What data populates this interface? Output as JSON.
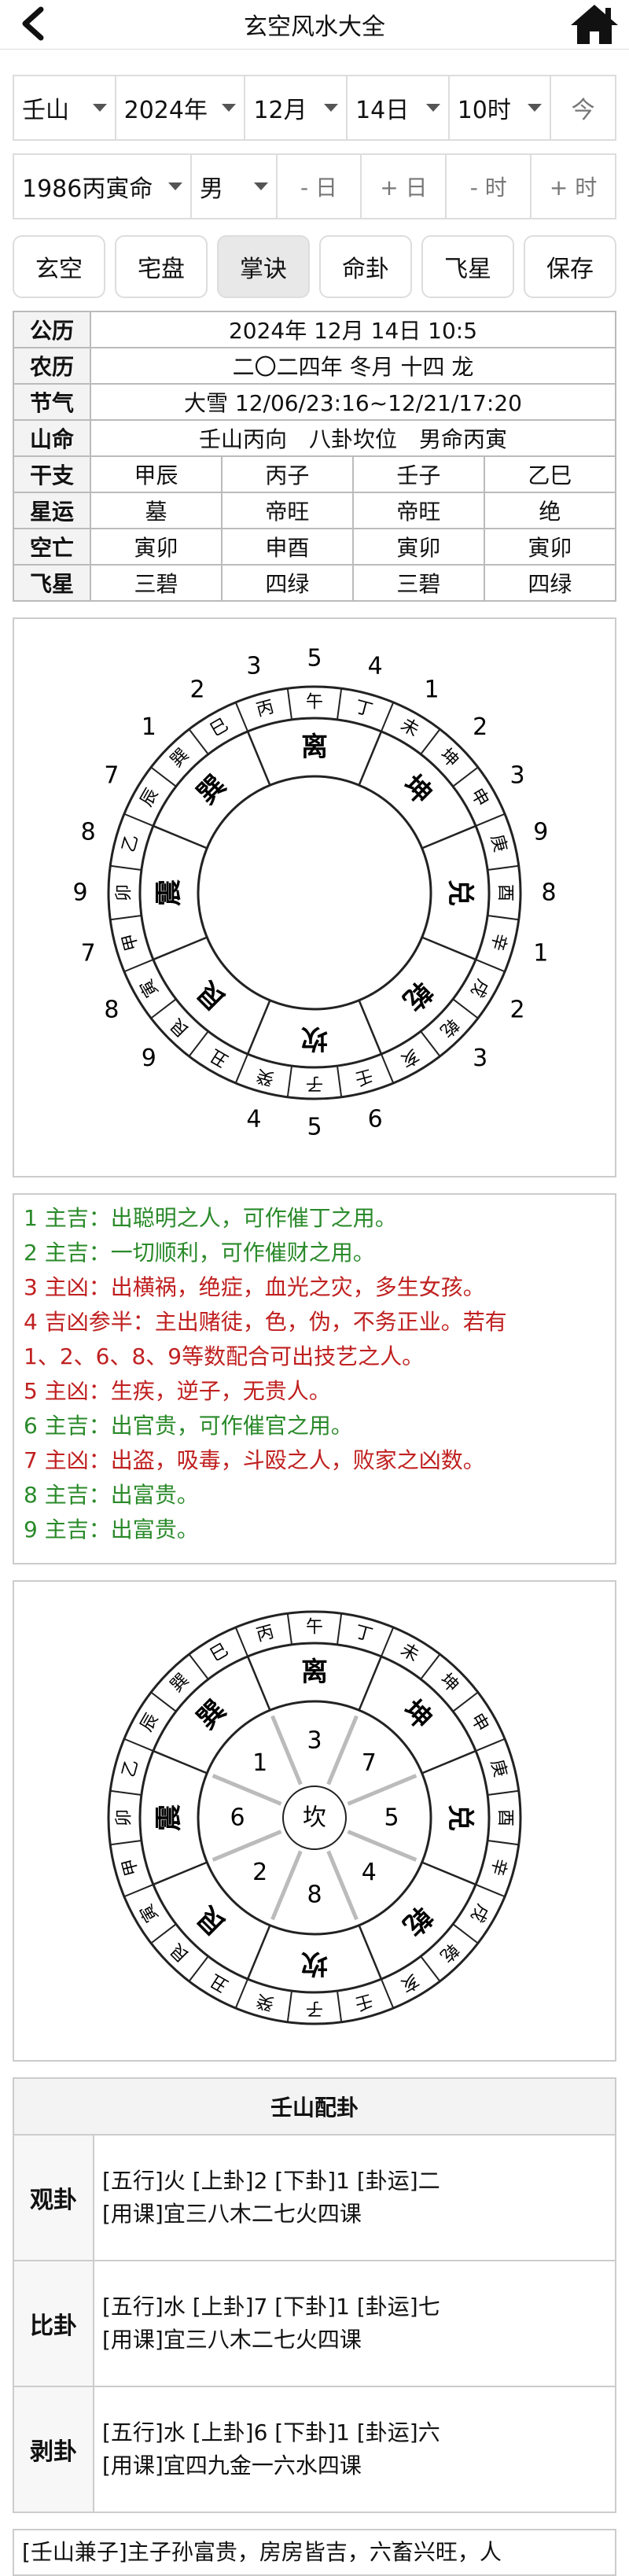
{
  "header": {
    "title": "玄空风水大全"
  },
  "selectors": {
    "mountain": "壬山",
    "year": "2024年",
    "month": "12月",
    "day": "14日",
    "hour": "10时",
    "today": "今",
    "birth": "1986丙寅命",
    "gender": "男",
    "adj": [
      "- 日",
      "+ 日",
      "- 时",
      "+ 时"
    ]
  },
  "buttons": [
    "玄空",
    "宅盘",
    "掌诀",
    "命卦",
    "飞星",
    "保存"
  ],
  "info": {
    "gongli": {
      "label": "公历",
      "value": "2024年 12月 14日 10:5"
    },
    "nongli": {
      "label": "农历",
      "value": "二〇二四年 冬月 十四 龙"
    },
    "jieqi": {
      "label": "节气",
      "value": "大雪 12/06/23:16~12/21/17:20"
    },
    "shanming": {
      "label": "山命",
      "value": "壬山丙向　八卦坎位　男命丙寅"
    },
    "ganzhi": {
      "label": "干支",
      "cells": [
        "甲辰",
        "丙子",
        "壬子",
        "乙巳"
      ]
    },
    "xingyun": {
      "label": "星运",
      "cells": [
        "墓",
        "帝旺",
        "帝旺",
        "绝"
      ]
    },
    "kongwang": {
      "label": "空亡",
      "cells": [
        "寅卯",
        "申酉",
        "寅卯",
        "寅卯"
      ]
    },
    "feixing": {
      "label": "飞星",
      "cells": [
        "三碧",
        "四绿",
        "三碧",
        "四绿"
      ]
    }
  },
  "wheel": {
    "mountains": [
      "午",
      "丁",
      "未",
      "坤",
      "申",
      "庚",
      "酉",
      "辛",
      "戌",
      "乾",
      "亥",
      "壬",
      "子",
      "癸",
      "丑",
      "艮",
      "寅",
      "甲",
      "卯",
      "乙",
      "辰",
      "巽",
      "巳",
      "丙"
    ],
    "trigrams": [
      "离",
      "坤",
      "兑",
      "乾",
      "坎",
      "艮",
      "震",
      "巽"
    ],
    "outer_numbers": [
      "5",
      "4",
      "1",
      "2",
      "3",
      "9",
      "8",
      "1",
      "2",
      "3",
      "6",
      "5",
      "4",
      "9",
      "8",
      "7",
      "9",
      "8",
      "7",
      "1",
      "2",
      "3"
    ],
    "center": "坎",
    "inner_numbers": [
      "3",
      "7",
      "5",
      "4",
      "8",
      "2",
      "6",
      "1"
    ]
  },
  "readings": [
    {
      "text": "1 主吉：出聪明之人，可作催丁之用。",
      "color": "g"
    },
    {
      "text": "2 主吉：一切顺利，可作催财之用。",
      "color": "g"
    },
    {
      "text": "3 主凶：出横祸，绝症，血光之灾，多生女孩。",
      "color": "r"
    },
    {
      "text": "4 吉凶参半：主出赌徒，色，伪，不务正业。若有",
      "color": "r"
    },
    {
      "text": "1、2、6、8、9等数配合可出技艺之人。",
      "color": "r"
    },
    {
      "text": "5 主凶：生疾，逆子，无贵人。",
      "color": "r"
    },
    {
      "text": "6 主吉：出官贵，可作催官之用。",
      "color": "g"
    },
    {
      "text": "7 主凶：出盗，吸毒，斗殴之人，败家之凶数。",
      "color": "r"
    },
    {
      "text": "8 主吉：出富贵。",
      "color": "g"
    },
    {
      "text": "9 主吉：出富贵。",
      "color": "g"
    }
  ],
  "peigua": {
    "title": "壬山配卦",
    "items": [
      {
        "name": "观卦",
        "line1": "[五行]火 [上卦]2 [下卦]1 [卦运]二",
        "line2": "[用课]宜三八木二七火四课"
      },
      {
        "name": "比卦",
        "line1": "[五行]水 [上卦]7 [下卦]1 [卦运]七",
        "line2": "[用课]宜三八木二七火四课"
      },
      {
        "name": "剥卦",
        "line1": "[五行]水 [上卦]6 [下卦]1 [卦运]六",
        "line2": "[用课]宜四九金一六水四课"
      }
    ]
  },
  "tail": "[壬山兼子]主子孙富贵，房房皆吉，六畜兴旺，人"
}
